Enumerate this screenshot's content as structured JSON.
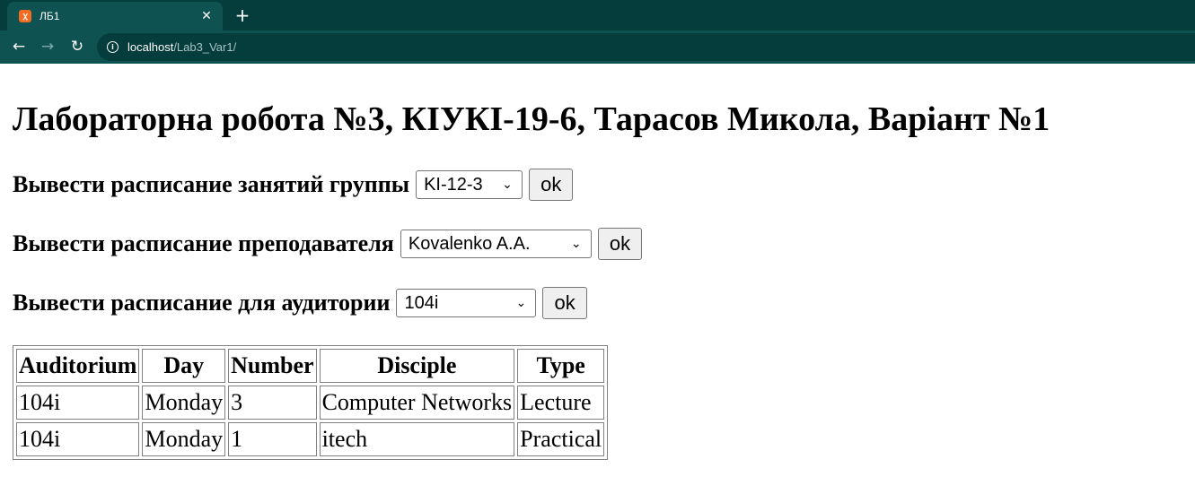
{
  "browser": {
    "tab_title": "ЛБ1",
    "favicon": "xampp-icon",
    "url_host": "localhost",
    "url_path": "/Lab3_Var1/"
  },
  "page": {
    "title": "Лабораторна робота №3, КІУКІ-19-6, Тарасов Микола, Варіант №1",
    "group_row": {
      "label": "Вывести расписание занятий группы",
      "selected": "KI-12-3",
      "button": "ok"
    },
    "teacher_row": {
      "label": "Вывести расписание преподавателя",
      "selected": "Kovalenko A.A.",
      "button": "ok"
    },
    "room_row": {
      "label": "Вывести расписание для аудитории",
      "selected": "104i",
      "button": "ok"
    }
  },
  "table": {
    "headers": [
      "Auditorium",
      "Day",
      "Number",
      "Disciple",
      "Type"
    ],
    "rows": [
      [
        "104i",
        "Monday",
        "3",
        "Computer Networks",
        "Lecture"
      ],
      [
        "104i",
        "Monday",
        "1",
        "itech",
        "Practical"
      ]
    ]
  }
}
